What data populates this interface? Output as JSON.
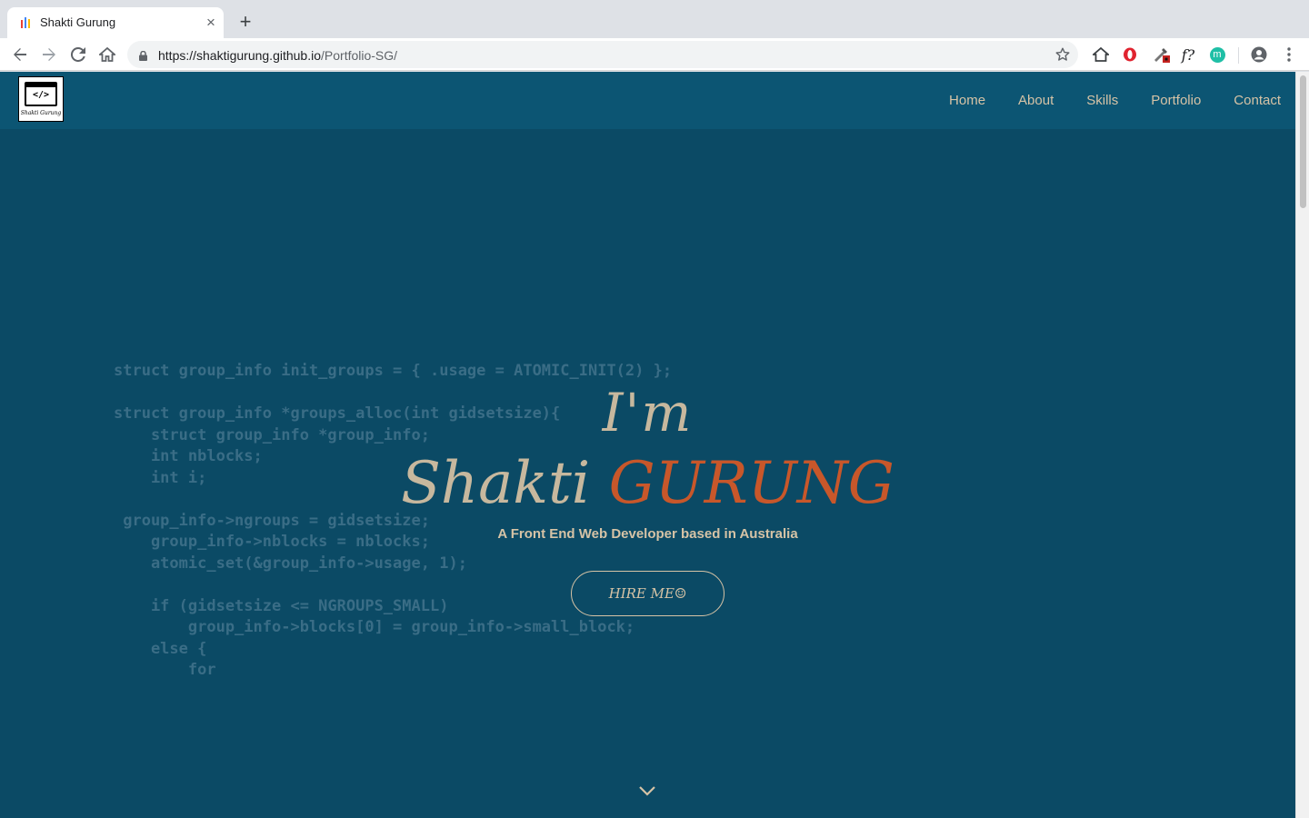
{
  "browser": {
    "tab_title": "Shakti Gurung",
    "tab_close": "×",
    "new_tab": "+",
    "url_host": "https://shaktigurung.github.io",
    "url_path": "/Portfolio-SG/",
    "icons": [
      "back-arrow-icon",
      "forward-arrow-icon",
      "reload-icon",
      "home-icon",
      "lock-icon",
      "star-icon",
      "home-extension-icon",
      "opera-icon",
      "colorzilla-icon",
      "whatfont-icon",
      "m-extension-icon",
      "profile-icon",
      "menu-icon"
    ],
    "ext_whatfont": "f?",
    "ext_m": "m"
  },
  "site": {
    "logo_code": "</>",
    "logo_name": "Shakti Gurung",
    "nav": [
      "Home",
      "About",
      "Skills",
      "Portfolio",
      "Contact"
    ],
    "code_background": "struct group_info init_groups = { .usage = ATOMIC_INIT(2) };\n\nstruct group_info *groups_alloc(int gidsetsize){\n    struct group_info *group_info;\n    int nblocks;\n    int i;\n\n group_info->ngroups = gidsetsize;\n    group_info->nblocks = nblocks;\n    atomic_set(&group_info->usage, 1);\n\n    if (gidsetsize <= NGROUPS_SMALL)\n        group_info->blocks[0] = group_info->small_block;\n    else {\n        for",
    "hero": {
      "intro": "I'm",
      "first_name": "Shakti",
      "last_name": "GURUNG",
      "tagline": "A Front End Web Developer based in Australia",
      "cta": "HIRE ME☺"
    },
    "colors": {
      "page_bg": "#0b4a65",
      "navbar_bg": "#0c5573",
      "accent": "#c8572a",
      "text": "#d6c3a6"
    }
  }
}
